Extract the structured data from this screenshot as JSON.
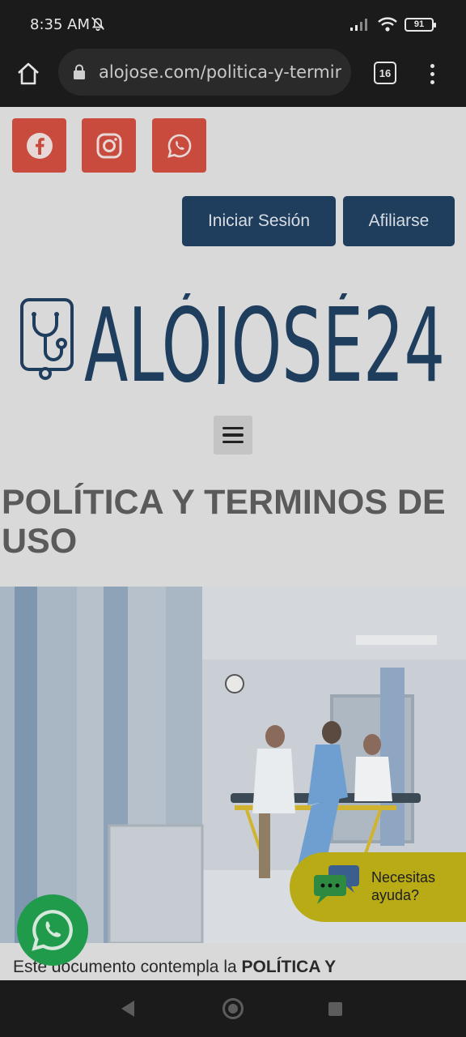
{
  "status_bar": {
    "time": "8:35 AM",
    "battery": "91",
    "icons": [
      "mute-bell-icon",
      "signal-icon",
      "wifi-icon",
      "battery-icon"
    ]
  },
  "browser": {
    "url": "alojose.com/politica-y-termir",
    "tab_count": "16",
    "icons": [
      "home-icon",
      "lock-icon",
      "tabs-icon",
      "overflow-menu-icon"
    ]
  },
  "header": {
    "social_icons": [
      "facebook-icon",
      "instagram-icon",
      "whatsapp-icon"
    ],
    "login_label": "Iniciar Sesión",
    "join_label": "Afiliarse",
    "logo_text": "ALÓJOSÉ24"
  },
  "main": {
    "title": "POLÍTICA Y TERMINOS DE USO",
    "body_prefix": "Este documento contempla la ",
    "body_bold": "POLÍTICA Y"
  },
  "help_widget": {
    "line1": "Necesitas",
    "line2": "ayuda?"
  },
  "colors": {
    "social_bg": "#c94b3d",
    "button_bg": "#1f3d5c",
    "logo": "#1f3d5c",
    "whatsapp": "#1f9b4b",
    "help_bg": "#b9ab15"
  }
}
